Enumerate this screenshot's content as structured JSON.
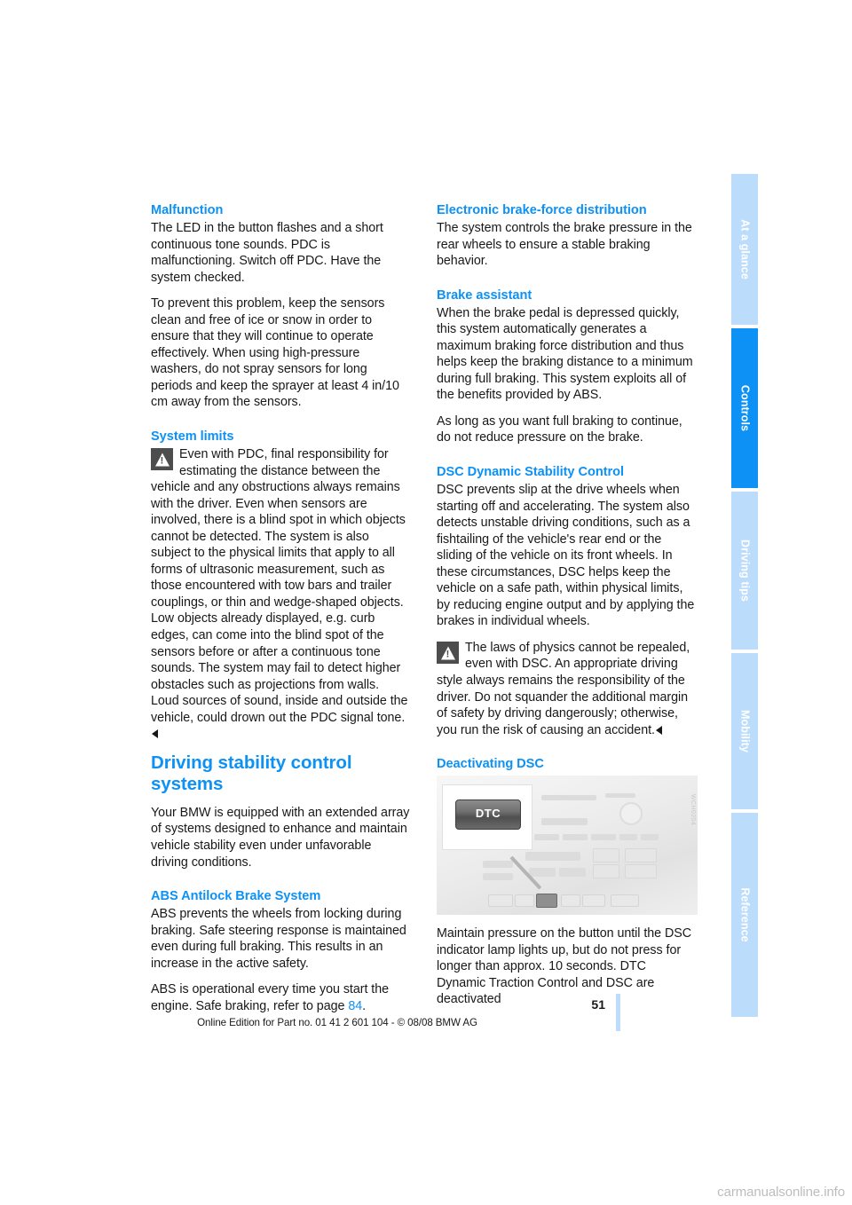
{
  "document": {
    "page_number": "51",
    "footer_line": "Online Edition for Part no. 01 41 2 601 104 - © 08/08 BMW AG",
    "site_watermark": "carmanualsonline.info",
    "accent_color": "#0d91f5"
  },
  "sidebar": {
    "tabs": [
      {
        "label": "At a glance",
        "active": false
      },
      {
        "label": "Controls",
        "active": true
      },
      {
        "label": "Driving tips",
        "active": false
      },
      {
        "label": "Mobility",
        "active": false
      },
      {
        "label": "Reference",
        "active": false
      }
    ]
  },
  "left_column": {
    "malfunction": {
      "heading": "Malfunction",
      "p1": "The LED in the button flashes and a short continuous tone sounds. PDC is malfunctioning. Switch off PDC. Have the system checked.",
      "p2": "To prevent this problem, keep the sensors clean and free of ice or snow in order to ensure that they will continue to operate effectively. When using high-pressure washers, do not spray sensors for long periods and keep the sprayer at least 4 in/10 cm away from the sensors."
    },
    "system_limits": {
      "heading": "System limits",
      "warning": "Even with PDC, final responsibility for estimating the distance between the vehicle and any obstructions always remains with the driver. Even when sensors are involved, there is a blind spot in which objects cannot be detected. The system is also subject to the physical limits that apply to all forms of ultrasonic measurement, such as those encountered with tow bars and trailer couplings, or thin and wedge-shaped objects. Low objects already displayed, e.g. curb edges, can come into the blind spot of the sensors before or after a continuous tone sounds. The system may fail to detect higher obstacles such as projections from walls.",
      "warning2": "Loud sources of sound, inside and outside the vehicle, could drown out the PDC signal tone."
    },
    "driving_stability": {
      "heading": "Driving stability control systems",
      "p1": "Your BMW is equipped with an extended array of systems designed to enhance and maintain vehicle stability even under unfavorable driving conditions."
    },
    "abs": {
      "heading": "ABS Antilock Brake System",
      "p1": "ABS prevents the wheels from locking during braking. Safe steering response is maintained even during full braking. This results in an increase in the active safety.",
      "p2_before": "ABS is operational every time you start the engine. Safe braking, refer to page ",
      "p2_link": "84",
      "p2_after": "."
    }
  },
  "right_column": {
    "ebd": {
      "heading": "Electronic brake-force distribution",
      "p1": "The system controls the brake pressure in the rear wheels to ensure a stable braking behavior."
    },
    "brake_assistant": {
      "heading": "Brake assistant",
      "p1": "When the brake pedal is depressed quickly, this system automatically generates a maximum braking force distribution and thus helps keep the braking distance to a minimum during full braking. This system exploits all of the benefits provided by ABS.",
      "p2": "As long as you want full braking to continue, do not reduce pressure on the brake."
    },
    "dsc": {
      "heading": "DSC Dynamic Stability Control",
      "p1": "DSC prevents slip at the drive wheels when starting off and accelerating. The system also detects unstable driving conditions, such as a fishtailing of the vehicle's rear end or the sliding of the vehicle on its front wheels. In these circumstances, DSC helps keep the vehicle on a safe path, within physical limits, by reducing engine output and by applying the brakes in individual wheels.",
      "warning": "The laws of physics cannot be repealed, even with DSC. An appropriate driving style always remains the responsibility of the driver. Do not squander the additional margin of safety by driving dangerously; otherwise, you run the risk of causing an accident."
    },
    "deactivating_dsc": {
      "heading": "Deactivating DSC",
      "figure_button_label": "DTC",
      "figure_watermark": "WCH0204",
      "p1": "Maintain pressure on the button until the DSC indicator lamp lights up, but do not press for longer than approx. 10 seconds. DTC Dynamic Traction Control and DSC are deactivated"
    }
  }
}
